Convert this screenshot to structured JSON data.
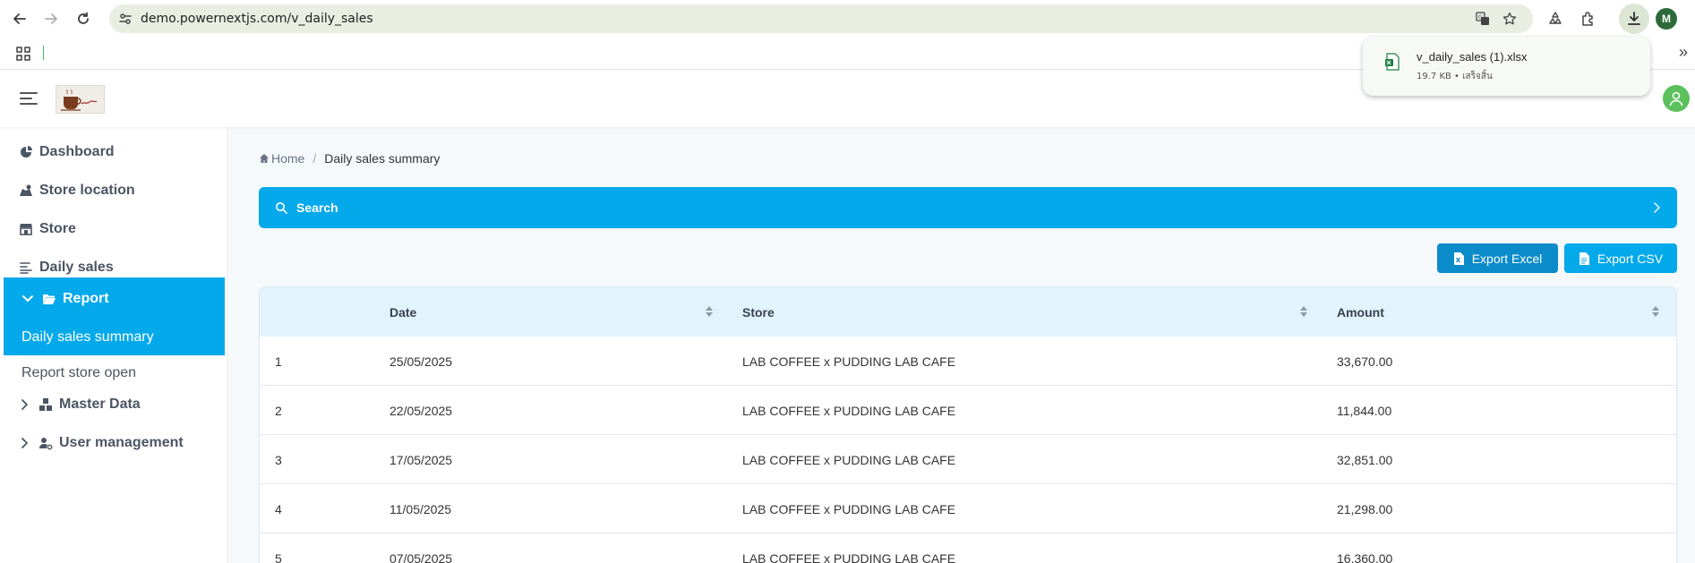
{
  "browser": {
    "url": "demo.powernextjs.com/v_daily_sales",
    "download": {
      "file_name": "v_daily_sales (1).xlsx",
      "meta": "19.7 KB • เสร็จสิ้น"
    },
    "profile_initial": "M",
    "bookmarks_more": "»"
  },
  "sidebar": {
    "items": [
      {
        "label": "Dashboard",
        "icon": "pie-chart-icon"
      },
      {
        "label": "Store location",
        "icon": "map-marker-icon"
      },
      {
        "label": "Store",
        "icon": "store-icon"
      },
      {
        "label": "Daily sales",
        "icon": "bar-list-icon"
      },
      {
        "label": "Report",
        "icon": "folder-open-icon"
      },
      {
        "label": "Master Data",
        "icon": "cubes-icon"
      },
      {
        "label": "User management",
        "icon": "user-cog-icon"
      }
    ],
    "sub_items": [
      {
        "label": "Daily sales summary"
      },
      {
        "label": "Report store open"
      }
    ]
  },
  "breadcrumb": {
    "home": "Home",
    "separator": "/",
    "current": "Daily sales summary"
  },
  "search": {
    "label": "Search"
  },
  "actions": {
    "export_excel": "Export Excel",
    "export_csv": "Export CSV"
  },
  "table": {
    "columns": [
      "",
      "Date",
      "Store",
      "Amount"
    ],
    "rows": [
      {
        "no": "1",
        "date": "25/05/2025",
        "store": "LAB COFFEE x PUDDING LAB CAFE",
        "amount": "33,670.00"
      },
      {
        "no": "2",
        "date": "22/05/2025",
        "store": "LAB COFFEE x PUDDING LAB CAFE",
        "amount": "11,844.00"
      },
      {
        "no": "3",
        "date": "17/05/2025",
        "store": "LAB COFFEE x PUDDING LAB CAFE",
        "amount": "32,851.00"
      },
      {
        "no": "4",
        "date": "11/05/2025",
        "store": "LAB COFFEE x PUDDING LAB CAFE",
        "amount": "21,298.00"
      },
      {
        "no": "5",
        "date": "07/05/2025",
        "store": "LAB COFFEE x PUDDING LAB CAFE",
        "amount": "16,360.00"
      }
    ]
  },
  "colors": {
    "accent": "#03a9ea",
    "export_excel": "#0b8bc9",
    "table_header": "#e3f3fc",
    "avatar": "#5cc05c"
  }
}
